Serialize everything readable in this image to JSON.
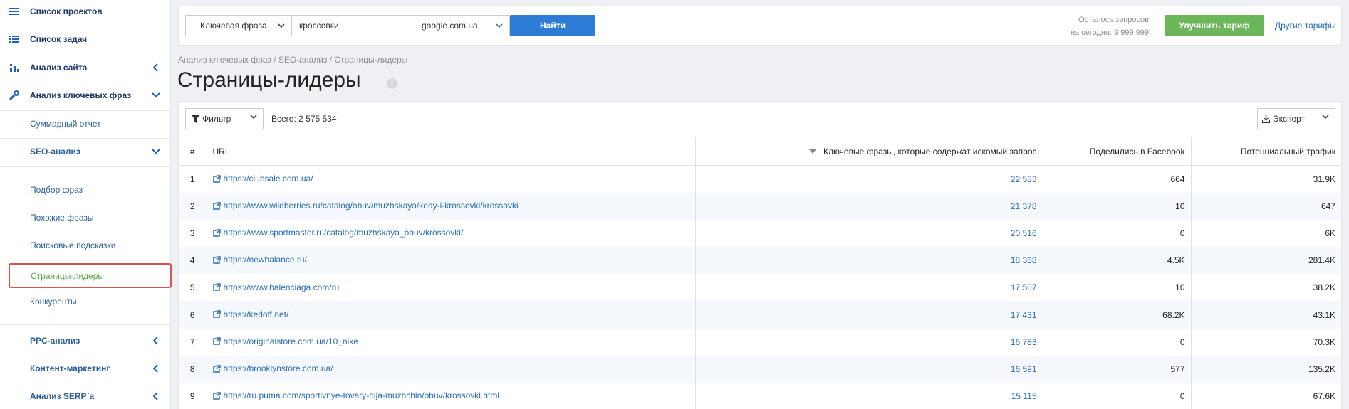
{
  "sidebar": {
    "items": [
      {
        "label": "Список проектов",
        "icon": "menu-icon",
        "chevron": ""
      },
      {
        "label": "Список задач",
        "icon": "tasks-list-icon",
        "chevron": ""
      },
      {
        "label": "Анализ сайта",
        "icon": "site-analysis-icon",
        "chevron": "left"
      },
      {
        "label": "Анализ ключевых фраз",
        "icon": "key-icon",
        "chevron": "down"
      }
    ],
    "sub_items": [
      {
        "label": "Суммарный отчет"
      },
      {
        "label": "SEO-анализ",
        "chevron": "down"
      },
      {
        "label": "Подбор фраз"
      },
      {
        "label": "Похожие фразы"
      },
      {
        "label": "Поисковые подсказки"
      },
      {
        "label": "Страницы-лидеры",
        "active": true
      },
      {
        "label": "Конкуренты"
      },
      {
        "label": "PPC-анализ",
        "chevron": "left"
      },
      {
        "label": "Контент-маркетинг",
        "chevron": "left"
      },
      {
        "label": "Анализ SERP`a",
        "chevron": "left"
      }
    ]
  },
  "search": {
    "type_select": "Ключевая фраза",
    "query": "кроссовки",
    "engine_select": "google.com.ua",
    "find_label": "Найти"
  },
  "quota": {
    "line1": "Осталось запросов",
    "line2": "на сегодня: 9 999 999"
  },
  "header": {
    "upgrade_label": "Улучшить тариф",
    "other_tariffs_label": "Другие тарифы"
  },
  "breadcrumb": "Анализ ключевых фраз / SEO-анализ / Страницы-лидеры",
  "page_title": "Страницы-лидеры",
  "toolbar": {
    "filter_label": "Фильтр",
    "total_label": "Всего: 2 575 534",
    "export_label": "Экспорт"
  },
  "table": {
    "columns": [
      "#",
      "URL",
      "Ключевые фразы, которые содержат искомый запрос",
      "Поделились в Facebook",
      "Потенциальный трафик"
    ],
    "rows": [
      {
        "n": "1",
        "url": "https://clubsale.com.ua/",
        "phrases": "22 583",
        "facebook": "664",
        "traffic": "31.9K"
      },
      {
        "n": "2",
        "url": "https://www.wildberries.ru/catalog/obuv/muzhskaya/kedy-i-krossovki/krossovki",
        "phrases": "21 378",
        "facebook": "10",
        "traffic": "647"
      },
      {
        "n": "3",
        "url": "https://www.sportmaster.ru/catalog/muzhskaya_obuv/krossovki/",
        "phrases": "20 516",
        "facebook": "0",
        "traffic": "6K"
      },
      {
        "n": "4",
        "url": "https://newbalance.ru/",
        "phrases": "18 368",
        "facebook": "4.5K",
        "traffic": "281.4K"
      },
      {
        "n": "5",
        "url": "https://www.balenciaga.com/ru",
        "phrases": "17 507",
        "facebook": "10",
        "traffic": "38.2K"
      },
      {
        "n": "6",
        "url": "https://kedoff.net/",
        "phrases": "17 431",
        "facebook": "68.2K",
        "traffic": "43.1K"
      },
      {
        "n": "7",
        "url": "https://originalstore.com.ua/10_nike",
        "phrases": "16 783",
        "facebook": "0",
        "traffic": "70.3K"
      },
      {
        "n": "8",
        "url": "https://brooklynstore.com.ua/",
        "phrases": "16 591",
        "facebook": "577",
        "traffic": "135.2K"
      },
      {
        "n": "9",
        "url": "https://ru.puma.com/sportivnye-tovary-dlja-muzhchin/obuv/krossovki.html",
        "phrases": "15 115",
        "facebook": "0",
        "traffic": "67.6K"
      }
    ]
  },
  "colors": {
    "accent": "#2d7cd6",
    "upgrade": "#6cb75a",
    "active_outline": "#d9534f",
    "active_text": "#5aa84a",
    "link": "#2a6db8"
  }
}
